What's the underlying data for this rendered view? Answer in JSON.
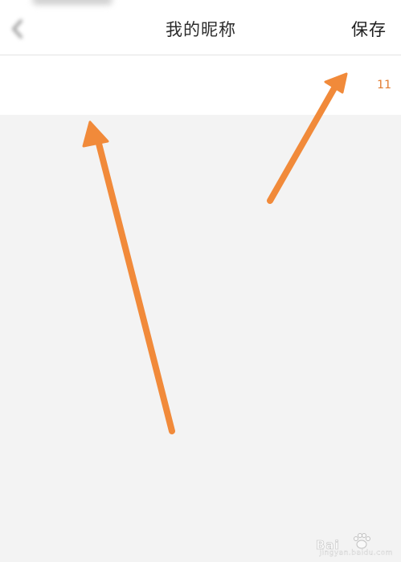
{
  "header": {
    "title": "我的昵称",
    "save_label": "保存",
    "back_icon": "chevron-left-icon"
  },
  "nickname": {
    "value": "",
    "char_count": "11"
  },
  "annotations": {
    "arrow_color": "#f18a3a"
  },
  "watermark": {
    "brand": "Bai",
    "sub": "jingyan.baidu.com"
  },
  "colors": {
    "accent": "#e27b2f",
    "background": "#f3f3f3",
    "panel": "#ffffff",
    "title_text": "#2b2b2b"
  }
}
